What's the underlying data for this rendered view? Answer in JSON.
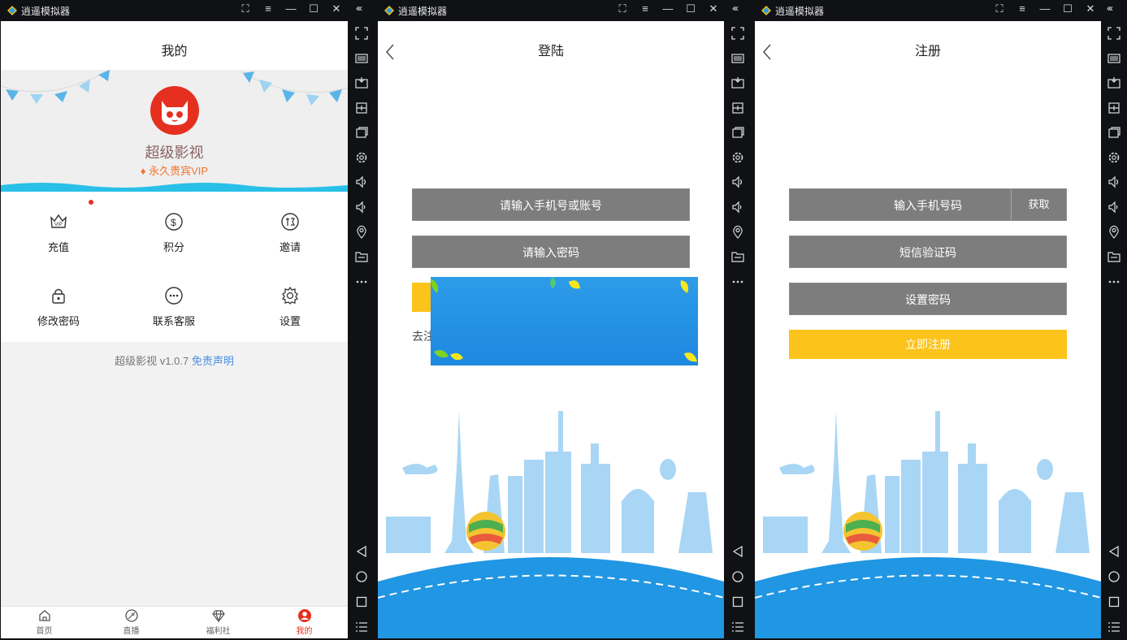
{
  "window": {
    "app_title": "逍遥模拟器",
    "collapse_label": "‹‹‹"
  },
  "profile": {
    "page_title": "我的",
    "brand_name": "超级影视",
    "vip_label": "永久贵宾VIP",
    "grid": [
      {
        "label": "充值",
        "icon": "vip-crown-icon"
      },
      {
        "label": "积分",
        "icon": "coin-icon"
      },
      {
        "label": "邀请",
        "icon": "invite-icon"
      },
      {
        "label": "修改密码",
        "icon": "lock-icon"
      },
      {
        "label": "联系客服",
        "icon": "chat-icon"
      },
      {
        "label": "设置",
        "icon": "gear-icon"
      }
    ],
    "version_text": "超级影视 v1.0.7",
    "disclaimer_link": "免责声明",
    "tabs": [
      {
        "label": "首页",
        "icon": "home-icon"
      },
      {
        "label": "直播",
        "icon": "live-icon"
      },
      {
        "label": "福利社",
        "icon": "diamond-icon"
      },
      {
        "label": "我的",
        "icon": "user-icon",
        "active": true
      }
    ],
    "accent_color": "#e5301f"
  },
  "login": {
    "page_title": "登陆",
    "account_placeholder": "请输入手机号或账号",
    "password_placeholder": "请输入密码",
    "goto_register_partial": "去注"
  },
  "register": {
    "page_title": "注册",
    "phone_placeholder": "输入手机号码",
    "get_code_label": "获取",
    "sms_placeholder": "短信验证码",
    "set_password_placeholder": "设置密码",
    "register_button": "立即注册",
    "button_color": "#fcc31a"
  }
}
